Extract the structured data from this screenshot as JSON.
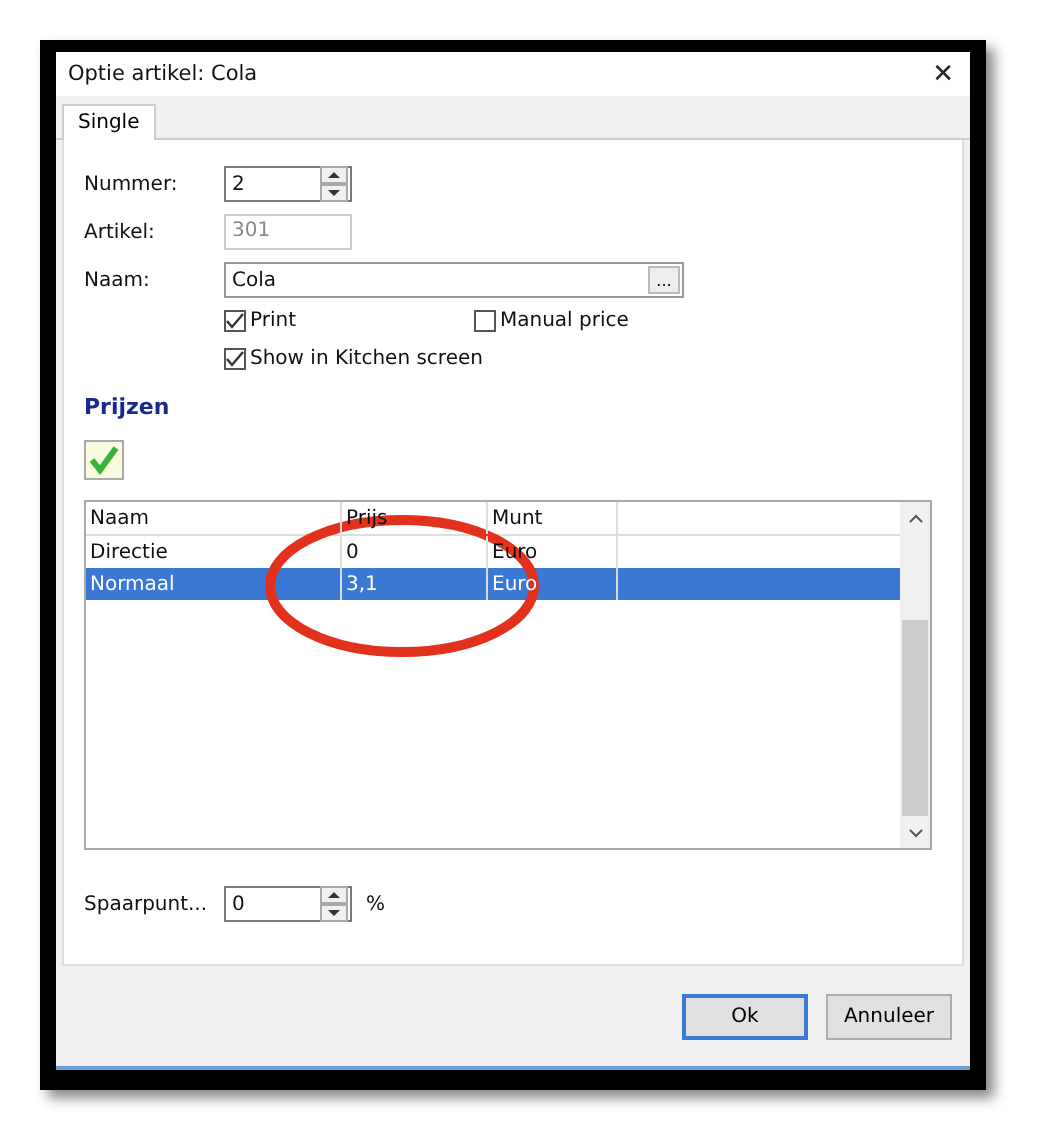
{
  "window": {
    "title": "Optie artikel: Cola",
    "close": "✕"
  },
  "tabs": [
    {
      "label": "Single",
      "selected": true
    }
  ],
  "fields": [
    {
      "label": "Nummer:",
      "value": "2",
      "kind": "spin"
    },
    {
      "label": "Artikel:",
      "value": "301",
      "kind": "text",
      "disabled": true
    },
    {
      "label": "Naam:",
      "value": "Cola",
      "kind": "browse",
      "button": "..."
    }
  ],
  "checkboxes": [
    {
      "label": "Print",
      "checked": true
    },
    {
      "label": "Manual price",
      "checked": false
    },
    {
      "label": "Show in Kitchen screen",
      "checked": true
    }
  ],
  "section": {
    "title": "Prijzen"
  },
  "table": {
    "columns": [
      "Naam",
      "Prijs",
      "Munt"
    ],
    "rows": [
      {
        "cells": [
          "Directie",
          "0",
          "Euro"
        ],
        "selected": false
      },
      {
        "cells": [
          "Normaal",
          "3,1",
          "Euro"
        ],
        "selected": true
      }
    ]
  },
  "spaarpunt": {
    "label": "Spaarpunt...",
    "value": "0",
    "unit": "%"
  },
  "buttons": [
    {
      "label": "Ok",
      "kind": "default"
    },
    {
      "label": "Annuleer",
      "kind": "normal"
    }
  ]
}
